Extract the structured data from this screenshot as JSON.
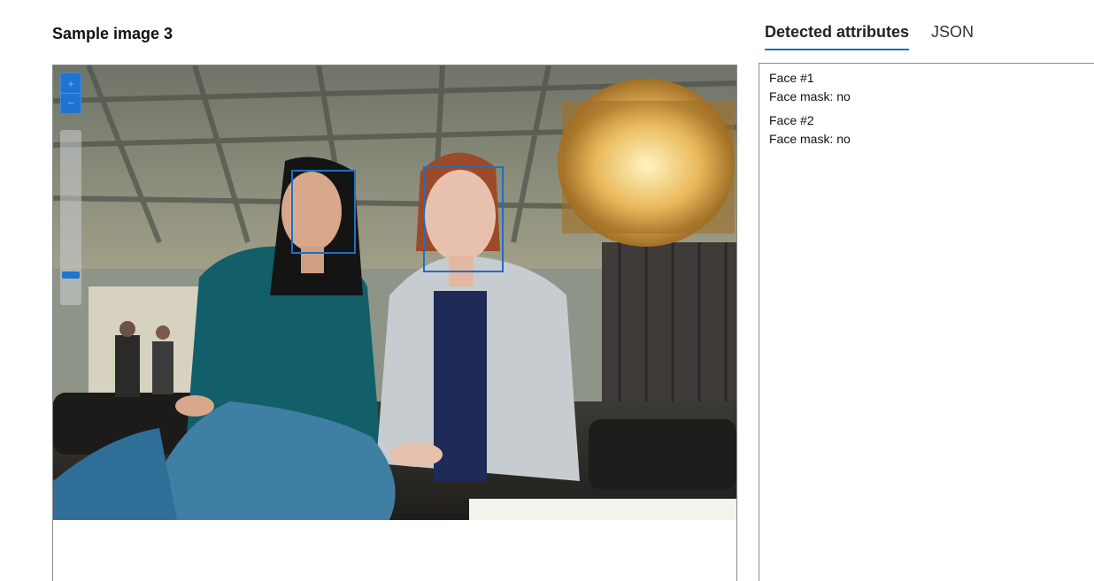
{
  "sample": {
    "title": "Sample image 3"
  },
  "tabs": [
    {
      "label": "Detected attributes",
      "active": true
    },
    {
      "label": "JSON",
      "active": false
    }
  ],
  "zoom": {
    "in_icon": "plus-icon",
    "out_icon": "minus-icon",
    "in_glyph": "+",
    "out_glyph": "−",
    "level": 0.15
  },
  "faces": [
    {
      "label": "Face #1",
      "mask": "Face mask: no"
    },
    {
      "label": "Face #2",
      "mask": "Face mask: no"
    }
  ],
  "colors": {
    "accent": "#1f6fc4",
    "border": "#8a8a8a"
  }
}
